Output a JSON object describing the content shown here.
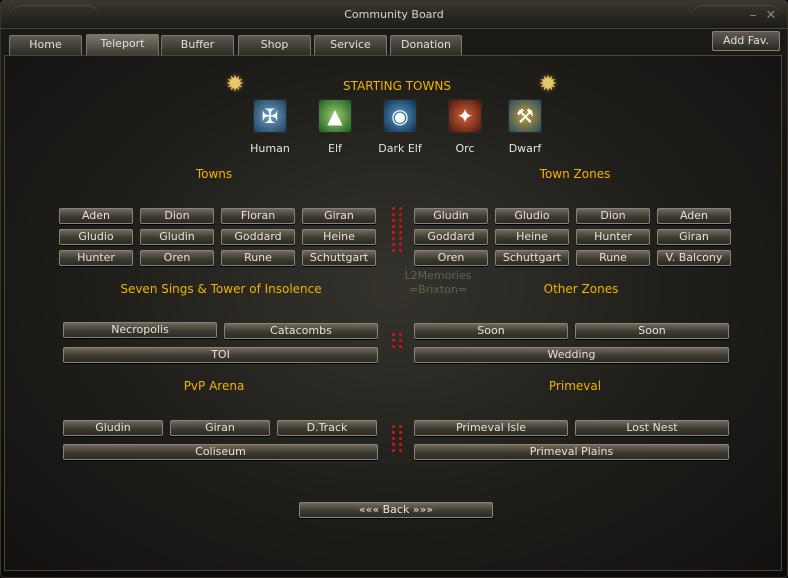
{
  "window": {
    "title": "Community Board",
    "minimize_icon": "minimize-icon",
    "close_icon": "close-icon"
  },
  "tabs": [
    "Home",
    "Teleport",
    "Buffer",
    "Shop",
    "Service",
    "Donation"
  ],
  "active_tab": "Teleport",
  "add_fav": "Add Fav.",
  "starting_towns": {
    "heading": "STARTING TOWNS",
    "races": [
      {
        "label": "Human",
        "icon": "human-crest-icon",
        "color": "#3b6a8c"
      },
      {
        "label": "Elf",
        "icon": "elf-crest-icon",
        "color": "#2c7f3a"
      },
      {
        "label": "Dark Elf",
        "icon": "dark-elf-crest-icon",
        "color": "#1d4f74"
      },
      {
        "label": "Orc",
        "icon": "orc-crest-icon",
        "color": "#7d2a1c"
      },
      {
        "label": "Dwarf",
        "icon": "dwarf-crest-icon",
        "color": "#24607a"
      }
    ]
  },
  "towns": {
    "heading": "Towns",
    "buttons": [
      "Aden",
      "Dion",
      "Floran",
      "Giran",
      "Gludio",
      "Gludin",
      "Goddard",
      "Heine",
      "Hunter",
      "Oren",
      "Rune",
      "Schuttgart"
    ]
  },
  "town_zones": {
    "heading": "Town Zones",
    "buttons": [
      "Gludin",
      "Gludio",
      "Dion",
      "Aden",
      "Goddard",
      "Heine",
      "Hunter",
      "Giran",
      "Oren",
      "Schuttgart",
      "Rune",
      "V. Balcony"
    ]
  },
  "seven_signs": {
    "heading": "Seven Sings & Tower of Insolence",
    "buttons": [
      "Necropolis",
      "Catacombs",
      "TOI"
    ]
  },
  "other_zones": {
    "heading": "Other Zones",
    "buttons": [
      "Soon",
      "Soon",
      "Wedding"
    ]
  },
  "pvp_arena": {
    "heading": "PvP Arena",
    "buttons": [
      "Gludin",
      "Giran",
      "D.Track",
      "Coliseum"
    ]
  },
  "primeval": {
    "heading": "Primeval",
    "buttons": [
      "Primeval Isle",
      "Lost Nest",
      "Primeval Plains"
    ]
  },
  "watermark": {
    "line1": "L2Memories",
    "line2": "=Brixton="
  },
  "back": "««« Back »»»",
  "colors": {
    "gold": "#f3b300",
    "dot": "#e01010"
  }
}
